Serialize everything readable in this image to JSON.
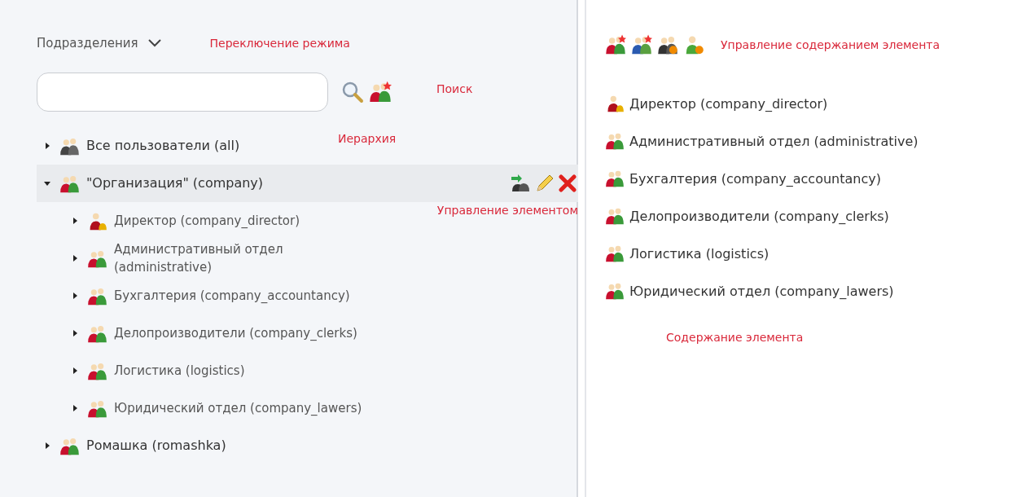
{
  "left_panel": {
    "mode_selector": {
      "label": "Подразделения",
      "note": "Переключение режима"
    },
    "search": {
      "placeholder_note": "Поиск"
    },
    "tree": {
      "note": "Иерархия",
      "actions_note": "Управление элементом",
      "items": [
        {
          "label": "Все пользователи (all)",
          "kind": "group-all",
          "expanded": false,
          "selected": false
        },
        {
          "label": "\"Организация\" (company)",
          "kind": "group",
          "expanded": true,
          "selected": true,
          "children": [
            {
              "label": "Директор (company_director)",
              "kind": "person",
              "expanded": false,
              "selected": false
            },
            {
              "label": "Административный отдел (administrative)",
              "kind": "group",
              "expanded": false,
              "selected": false
            },
            {
              "label": "Бухгалтерия (company_accountancy)",
              "kind": "group",
              "expanded": false,
              "selected": false
            },
            {
              "label": "Делопроизводители (company_clerks)",
              "kind": "group",
              "expanded": false,
              "selected": false
            },
            {
              "label": "Логистика (logistics)",
              "kind": "group",
              "expanded": false,
              "selected": false
            },
            {
              "label": "Юридический отдел (company_lawers)",
              "kind": "group",
              "expanded": false,
              "selected": false
            }
          ]
        },
        {
          "label": "Ромашка (romashka)",
          "kind": "group",
          "expanded": false,
          "selected": false
        }
      ]
    }
  },
  "right_panel": {
    "toolbar": {
      "note": "Управление содержанием элемента",
      "tools": [
        {
          "kind": "add-group"
        },
        {
          "kind": "add-group-blue"
        },
        {
          "kind": "group-orange"
        },
        {
          "kind": "user-orange"
        }
      ]
    },
    "items": [
      {
        "label": "Директор (company_director)",
        "kind": "person"
      },
      {
        "label": "Административный отдел (administrative)",
        "kind": "group"
      },
      {
        "label": "Бухгалтерия (company_accountancy)",
        "kind": "group"
      },
      {
        "label": "Делопроизводители (company_clerks)",
        "kind": "group"
      },
      {
        "label": "Логистика (logistics)",
        "kind": "group"
      },
      {
        "label": "Юридический отдел (company_lawers)",
        "kind": "group"
      }
    ],
    "content_note": "Содержание элемента"
  }
}
